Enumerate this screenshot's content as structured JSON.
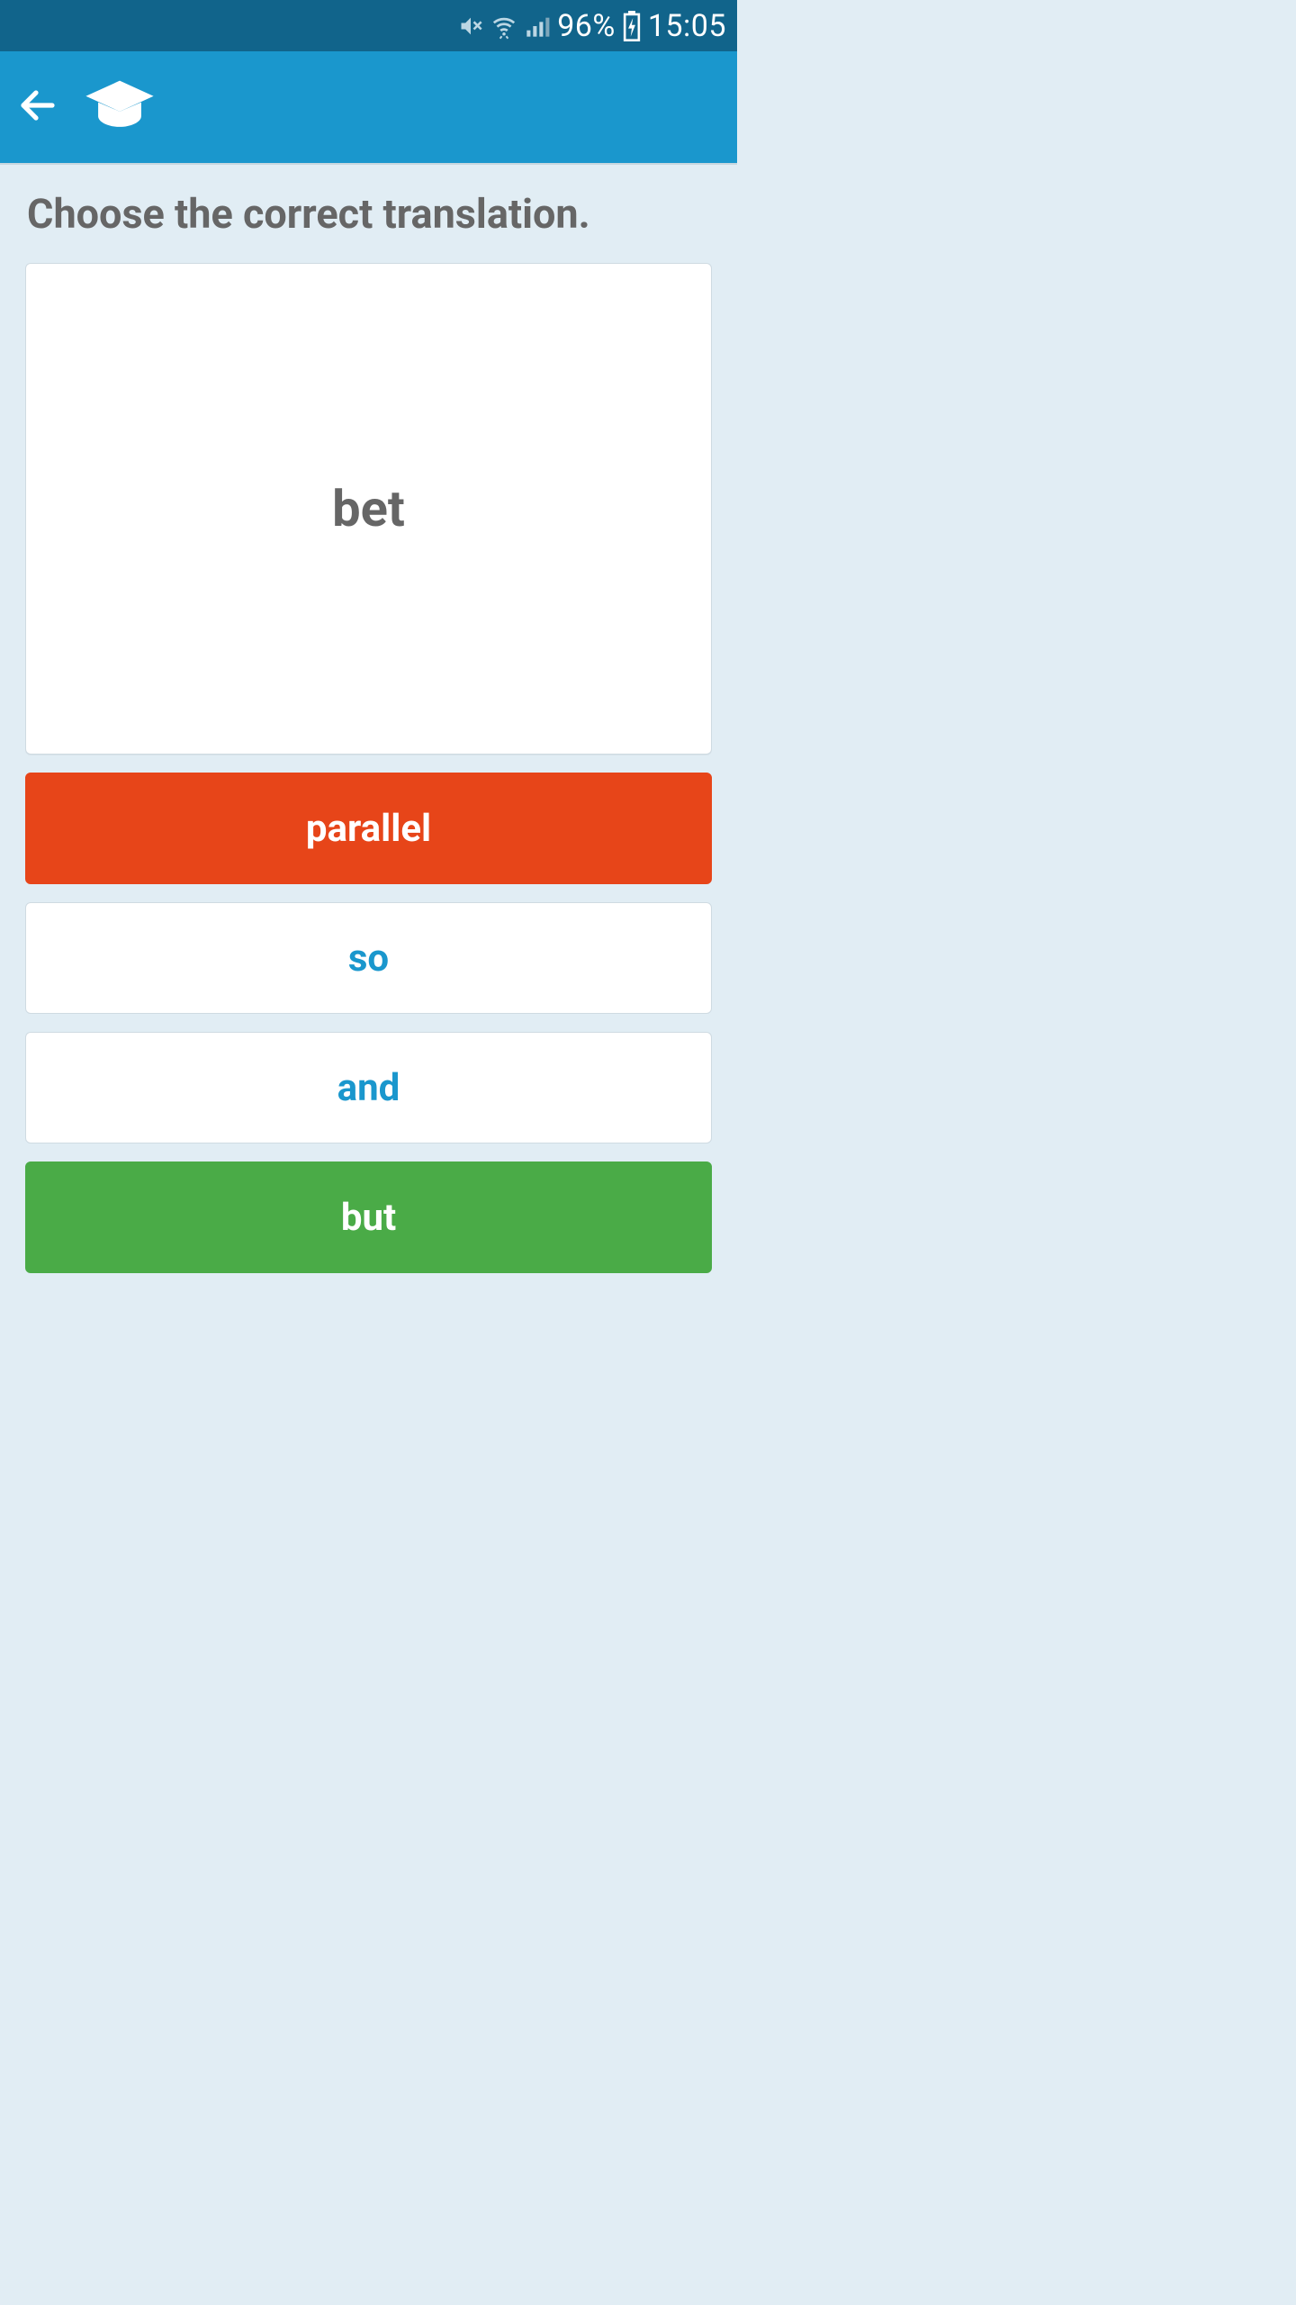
{
  "status": {
    "battery": "96%",
    "time": "15:05"
  },
  "prompt": "Choose the correct translation.",
  "card": {
    "word": "bet"
  },
  "options": [
    {
      "label": "parallel",
      "state": "selected"
    },
    {
      "label": "so",
      "state": "default"
    },
    {
      "label": "and",
      "state": "default"
    },
    {
      "label": "but",
      "state": "correct"
    }
  ]
}
